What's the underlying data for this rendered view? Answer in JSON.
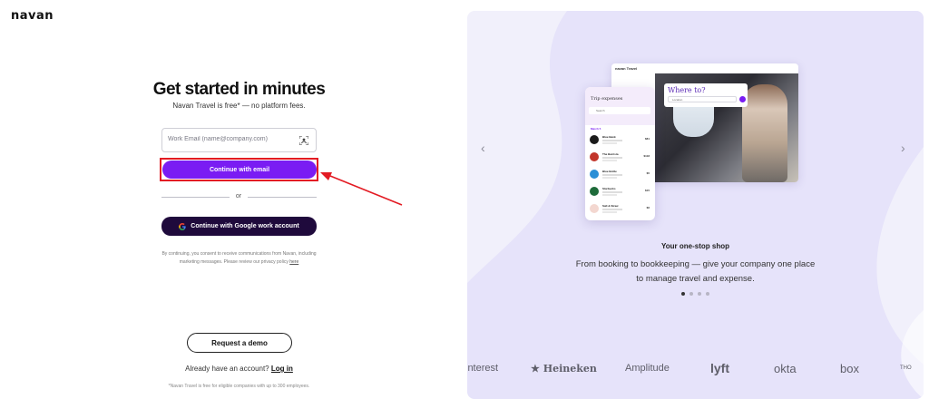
{
  "brand": {
    "logo": "navan"
  },
  "signup": {
    "headline": "Get started in minutes",
    "subhead": "Navan Travel is free* — no platform fees.",
    "email_placeholder": "Work Email (name@company.com)",
    "email_value": "",
    "continue_email_label": "Continue with email",
    "or_label": "or",
    "google_label": "Continue with Google work account",
    "consent_text": "By continuing, you consent to receive communications from Navan, including marketing messages. Please review our privacy policy",
    "consent_link": "here",
    "demo_label": "Request a demo",
    "already_text": "Already have an account?",
    "login_label": "Log in",
    "footnote": "*Navan Travel is free for eligible companies with up to 300 employees."
  },
  "annotation": {
    "highlight_color": "#e31b23"
  },
  "showcase": {
    "mock_window_title": "navan Travel",
    "where_title": "Where to?",
    "where_placeholder": "Location",
    "phone_title": "Trip expenses",
    "phone_search": "Search",
    "phone_month": "March 5",
    "expenses": [
      {
        "name": "Blue Bank",
        "amount": "$81",
        "color": "#1a1a1a"
      },
      {
        "name": "The Barrista",
        "amount": "$118",
        "color": "#c2352a"
      },
      {
        "name": "Blue Bottle",
        "amount": "$5",
        "color": "#2a8fd6"
      },
      {
        "name": "Starbucks",
        "amount": "$15",
        "color": "#1e6b3a"
      },
      {
        "name": "Salt & Straw",
        "amount": "$6",
        "color": "#f3d7d0"
      }
    ],
    "tagline": "Your one-stop shop",
    "description": "From booking to bookkeeping — give your company one place to manage travel and expense.",
    "prev_arrow": "‹",
    "next_arrow": "›",
    "slide_count": 4,
    "active_slide": 1
  },
  "customer_logos": [
    "interest",
    "★ Heineken",
    "Amplitude",
    "lyft",
    "okta",
    "box",
    "THO"
  ],
  "colors": {
    "primary": "#7a1cf3",
    "dark": "#1f0a3c",
    "panel": "#f1f0fb"
  }
}
